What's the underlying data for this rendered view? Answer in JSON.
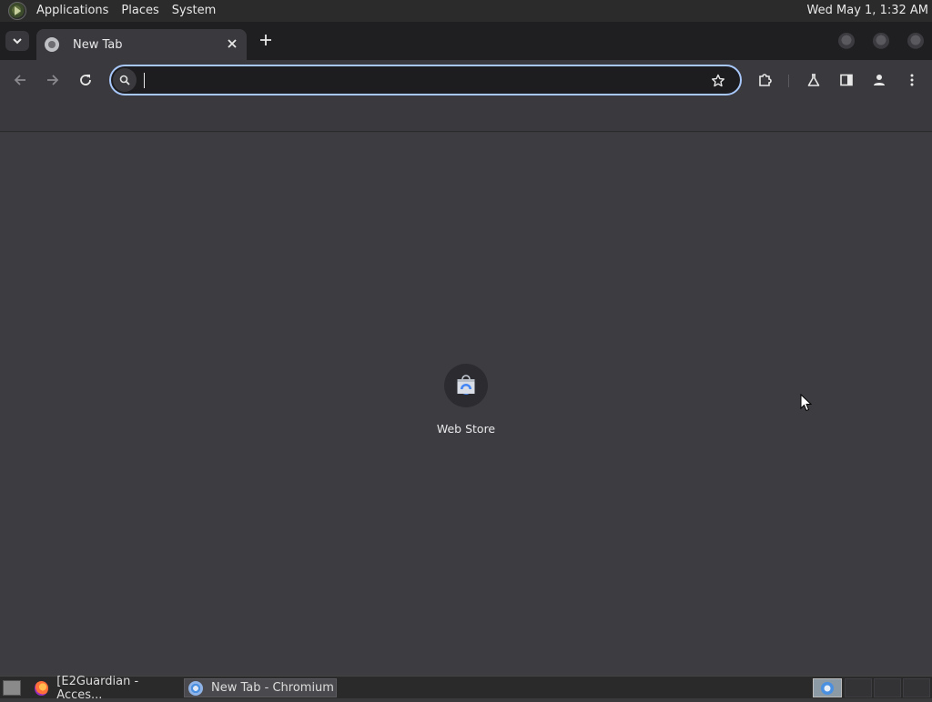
{
  "top_panel": {
    "menus": [
      "Applications",
      "Places",
      "System"
    ],
    "clock": "Wed May 1,  1:32 AM"
  },
  "browser": {
    "tab": {
      "title": "New Tab"
    },
    "omnibox": {
      "value": "",
      "placeholder": ""
    },
    "shortcuts": [
      {
        "label": "Web Store",
        "icon": "web-store-icon"
      }
    ]
  },
  "taskbar": {
    "tasks": [
      {
        "label": "[E2Guardian - Acces...",
        "icon": "firefox-icon",
        "active": false
      },
      {
        "label": "New Tab - Chromium",
        "icon": "chromium-icon",
        "active": true
      }
    ]
  },
  "colors": {
    "accent": "#a8c7fa",
    "tab_bg": "#3a3a3e",
    "content_bg": "#3d3d41"
  }
}
